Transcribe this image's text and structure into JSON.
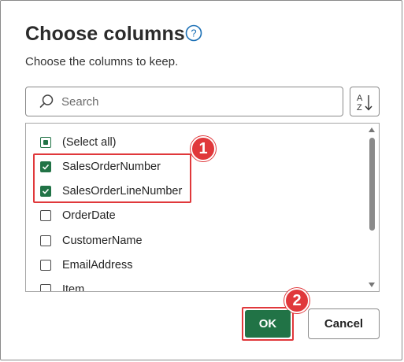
{
  "dialog": {
    "title": "Choose columns",
    "subtitle": "Choose the columns to keep.",
    "help_icon": "question-circle-icon"
  },
  "search": {
    "placeholder": "Search",
    "icon": "search-icon"
  },
  "sort": {
    "icon": "sort-az-icon",
    "label_a": "A",
    "label_z": "Z"
  },
  "columns": [
    {
      "label": "(Select all)",
      "state": "partial"
    },
    {
      "label": "SalesOrderNumber",
      "state": "checked"
    },
    {
      "label": "SalesOrderLineNumber",
      "state": "checked"
    },
    {
      "label": "OrderDate",
      "state": "unchecked"
    },
    {
      "label": "CustomerName",
      "state": "unchecked"
    },
    {
      "label": "EmailAddress",
      "state": "unchecked"
    },
    {
      "label": "Item",
      "state": "unchecked"
    }
  ],
  "annotations": {
    "badge_1": "1",
    "badge_2": "2",
    "color": "#e0383b"
  },
  "buttons": {
    "ok": "OK",
    "cancel": "Cancel"
  },
  "colors": {
    "accent": "#217346"
  }
}
